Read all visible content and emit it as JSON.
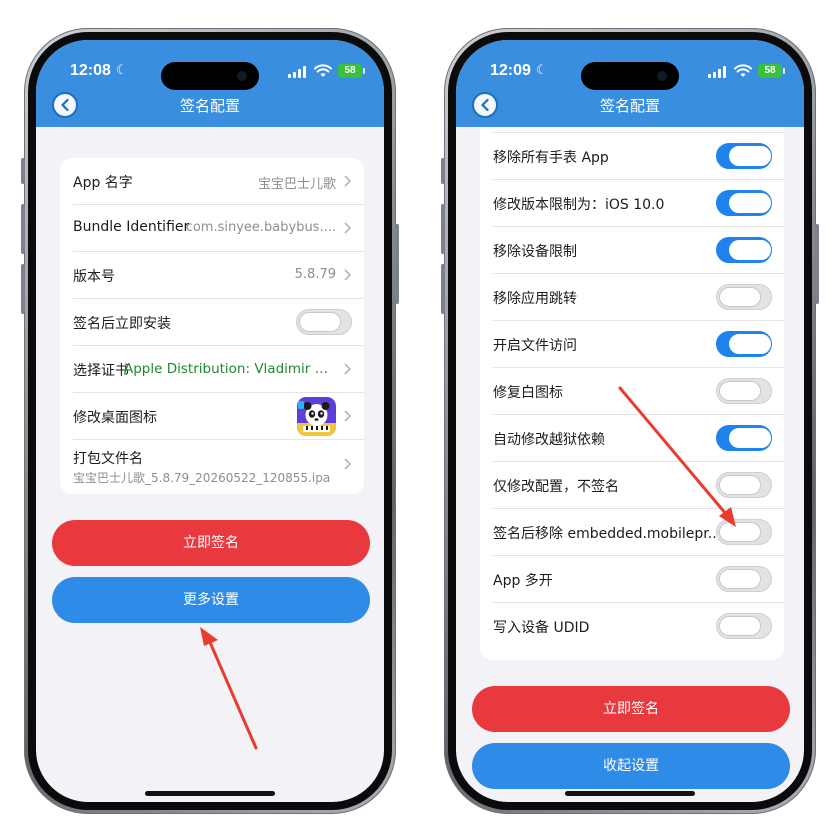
{
  "colors": {
    "header": "#3a8ee0",
    "toggle_on": "#1e83ec",
    "sign_button": "#e8393f",
    "settings_button": "#2f8be8",
    "cert_text": "#1f8a2e",
    "battery": "#3ac13a",
    "arrow": "#ea3b2e"
  },
  "left_screen": {
    "status": {
      "time": "12:08",
      "battery": "58"
    },
    "nav_title": "签名配置",
    "rows": [
      {
        "label": "App 名字",
        "value": "宝宝巴士儿歌"
      },
      {
        "label": "Bundle Identifier",
        "value": "com.sinyee.babybus...."
      },
      {
        "label": "版本号",
        "value": "5.8.79"
      },
      {
        "label": "签名后立即安装",
        "toggle": false
      },
      {
        "label": "选择证书",
        "value": "Apple Distribution: Vladimir U..."
      },
      {
        "label": "修改桌面图标",
        "icon": "panda-app-icon"
      },
      {
        "label": "打包文件名",
        "sub": "宝宝巴士儿歌_5.8.79_20260522_120855.ipa"
      }
    ],
    "sign_button": "立即签名",
    "more_button": "更多设置"
  },
  "right_screen": {
    "status": {
      "time": "12:09",
      "battery": "58"
    },
    "nav_title": "签名配置",
    "rows": [
      {
        "label": "移除所有手表 App",
        "toggle": true
      },
      {
        "label": "修改版本限制为：iOS 10.0",
        "toggle": true
      },
      {
        "label": "移除设备限制",
        "toggle": true
      },
      {
        "label": "移除应用跳转",
        "toggle": false
      },
      {
        "label": "开启文件访问",
        "toggle": true
      },
      {
        "label": "修复白图标",
        "toggle": false
      },
      {
        "label": "自动修改越狱依赖",
        "toggle": true
      },
      {
        "label": "仅修改配置，不签名",
        "toggle": false
      },
      {
        "label": "签名后移除 embedded.mobilepr...",
        "toggle": false
      },
      {
        "label": "App 多开",
        "toggle": false
      },
      {
        "label": "写入设备 UDID",
        "toggle": false
      }
    ],
    "sign_button": "立即签名",
    "collapse_button": "收起设置"
  }
}
